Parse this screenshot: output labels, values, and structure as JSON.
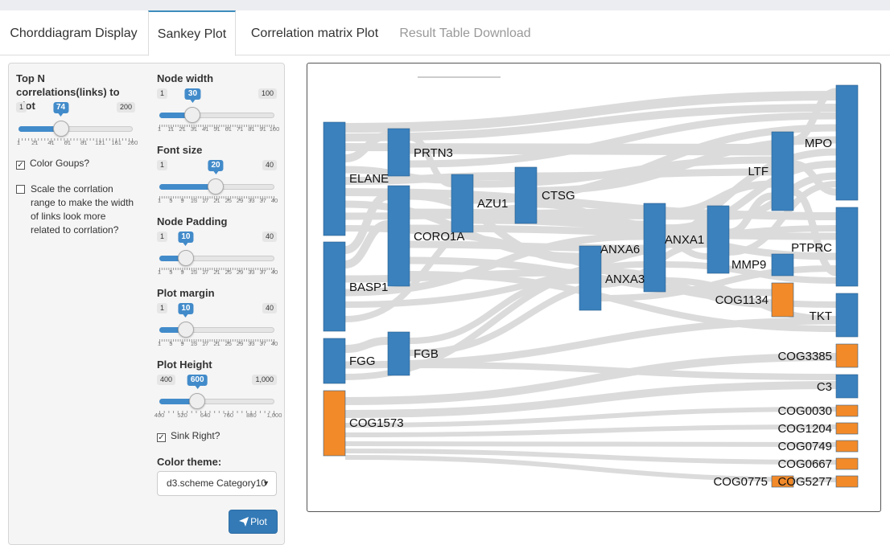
{
  "tabs": [
    {
      "label": "Chorddiagram Display"
    },
    {
      "label": "Sankey Plot"
    },
    {
      "label": "Correlation matrix Plot"
    },
    {
      "label": "Result Table Download"
    }
  ],
  "sidebar": {
    "topn": {
      "label": "Top N correlations(links) to plot",
      "min": "1",
      "max": "200",
      "value": "74",
      "fraction": 0.37,
      "ticks": [
        "1",
        "21",
        "41",
        "61",
        "81",
        "121",
        "161",
        "200"
      ]
    },
    "color_groups": {
      "label": "Color Goups?",
      "checked": true
    },
    "scale": {
      "label": "Scale the corrlation range to make the width of links look more related to corrlation?",
      "checked": false
    },
    "node_width": {
      "label": "Node width",
      "min": "1",
      "max": "100",
      "value": "30",
      "fraction": 0.29,
      "ticks": [
        "1",
        "11",
        "21",
        "31",
        "41",
        "51",
        "61",
        "71",
        "81",
        "91",
        "100"
      ]
    },
    "font_size": {
      "label": "Font size",
      "min": "1",
      "max": "40",
      "value": "20",
      "fraction": 0.49,
      "ticks": [
        "1",
        "5",
        "9",
        "13",
        "17",
        "21",
        "25",
        "29",
        "33",
        "37",
        "40"
      ]
    },
    "node_padding": {
      "label": "Node Padding",
      "min": "1",
      "max": "40",
      "value": "10",
      "fraction": 0.23,
      "ticks": [
        "1",
        "5",
        "9",
        "13",
        "17",
        "21",
        "25",
        "29",
        "33",
        "37",
        "40"
      ]
    },
    "plot_margin": {
      "label": "Plot margin",
      "min": "1",
      "max": "40",
      "value": "10",
      "fraction": 0.23,
      "ticks": [
        "1",
        "5",
        "9",
        "13",
        "17",
        "21",
        "25",
        "29",
        "33",
        "37",
        "40"
      ]
    },
    "plot_height": {
      "label": "Plot Height",
      "min": "400",
      "max": "1,000",
      "value": "600",
      "fraction": 0.33,
      "ticks": [
        "400",
        "520",
        "640",
        "760",
        "880",
        "1,000"
      ]
    },
    "sink_right": {
      "label": "Sink Right?",
      "checked": true
    },
    "color_theme": {
      "label": "Color theme:",
      "value": "d3.scheme Category10"
    },
    "plot_button": {
      "label": "Plot"
    }
  },
  "colors": {
    "blue": "#3a81bd",
    "orange": "#f28a2a",
    "link": "#bfbfbf",
    "accent": "#428bca"
  },
  "sankey": {
    "nodes": [
      "ELANE",
      "BASP1",
      "FGG",
      "COG1573",
      "PRTN3",
      "CORO1A",
      "FGB",
      "AZU1",
      "CTSG",
      "ANXA6",
      "ANXA3",
      "ANXA1",
      "MMP9",
      "COG1134",
      "LTF",
      "MPO",
      "PTPRC",
      "TKT",
      "COG3385",
      "C3",
      "COG0030",
      "COG1204",
      "COG0749",
      "COG0667",
      "COG0775",
      "COG5277"
    ]
  }
}
